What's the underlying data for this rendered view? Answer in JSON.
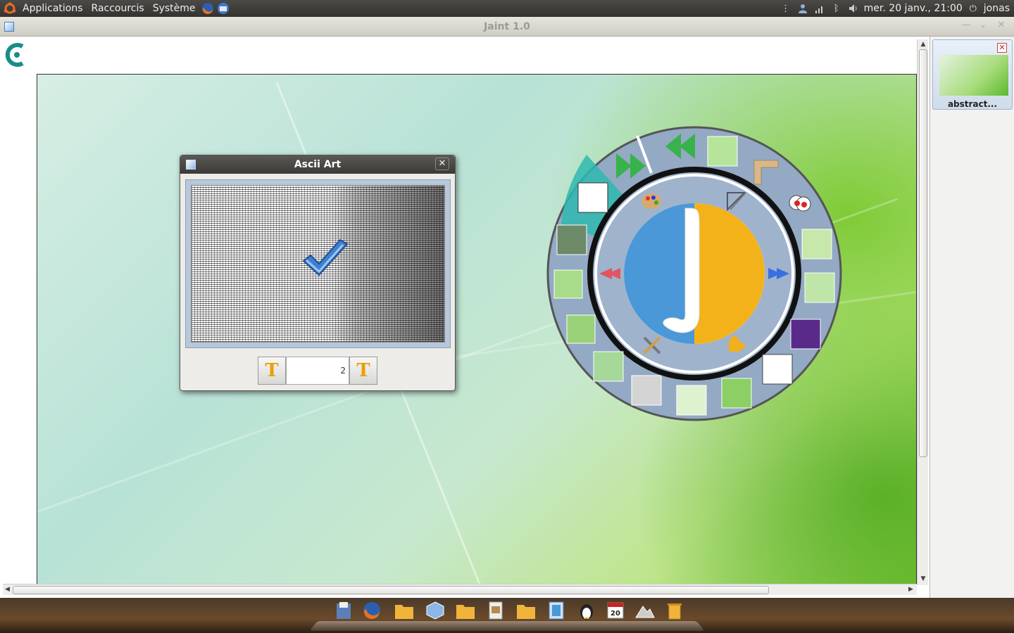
{
  "top_panel": {
    "menu": [
      "Applications",
      "Raccourcis",
      "Système"
    ],
    "clock": "mer. 20 janv., 21:00",
    "user": "jonas"
  },
  "window": {
    "title": "Jaint 1.0"
  },
  "sidebar": {
    "thumbnail_label": "abstract..."
  },
  "dialog": {
    "title": "Ascii Art",
    "spinner_value": "2",
    "button_glyph": "T"
  },
  "dock": {
    "items": [
      "files-icon",
      "firefox-icon",
      "folder-icon",
      "cube-icon",
      "folder-icon",
      "document-icon",
      "folder-icon",
      "jaint-icon",
      "tux-icon",
      "calendar-icon",
      "photo-icon",
      "trash-icon"
    ],
    "calendar_day": "20"
  },
  "colors": {
    "accent": "#2fb8b0",
    "radial_ring": "#93a9c4",
    "dialog_title": "#3b3a36"
  }
}
